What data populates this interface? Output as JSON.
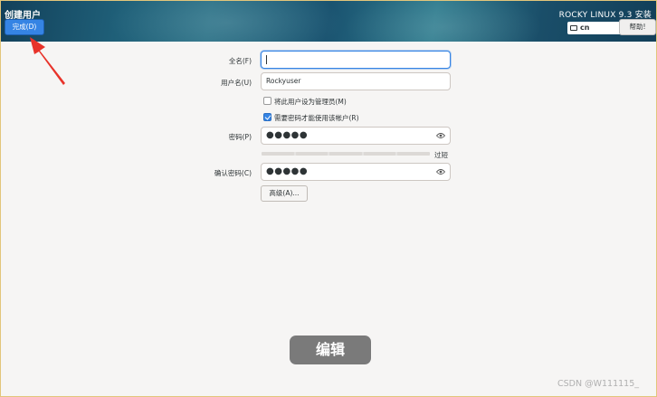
{
  "header": {
    "title": "创建用户",
    "done_label": "完成(D)",
    "product": "ROCKY LINUX 9.3 安装",
    "keyboard_layout": "cn",
    "help_label": "帮助!"
  },
  "form": {
    "fullname_label": "全名(F)",
    "fullname_value": "",
    "username_label": "用户名(U)",
    "username_value": "Rockyuser",
    "admin_checkbox": {
      "label": "将此用户设为管理员(M)",
      "checked": false
    },
    "require_pw_checkbox": {
      "label": "需要密码才能使用该帐户(R)",
      "checked": true
    },
    "password_label": "密码(P)",
    "password_value": "●●●●●",
    "strength_label": "过短",
    "confirm_label": "确认密码(C)",
    "confirm_value": "●●●●●",
    "advanced_label": "高级(A)..."
  },
  "overlay": {
    "badge_text": "编辑",
    "watermark": "CSDN @W111115_"
  },
  "colors": {
    "accent": "#3584e4",
    "annotation_arrow": "#e8332a"
  }
}
